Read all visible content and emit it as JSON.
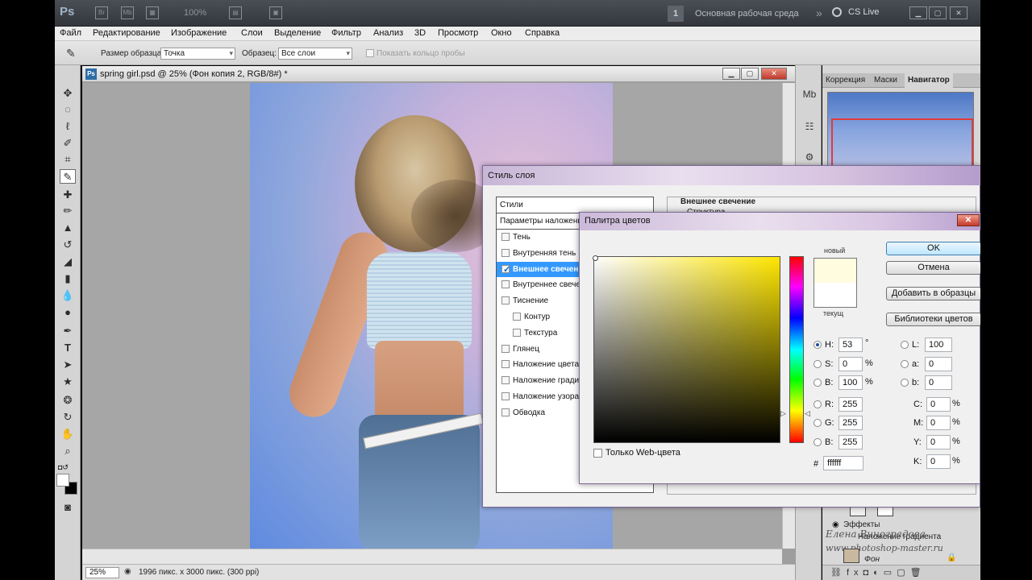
{
  "appbar": {
    "app_icon": "Ps",
    "zoom": "100%",
    "workspace_number": "1",
    "workspace": "Основная рабочая среда",
    "cs_live": "CS Live"
  },
  "menu": [
    "Файл",
    "Редактирование",
    "Изображение",
    "Слои",
    "Выделение",
    "Фильтр",
    "Анализ",
    "3D",
    "Просмотр",
    "Окно",
    "Справка"
  ],
  "options": {
    "sample_size_label": "Размер образца:",
    "sample_size_value": "Точка",
    "sample_label": "Образец:",
    "sample_value": "Все слои",
    "show_ring_label": "Показать кольцо пробы"
  },
  "document": {
    "title": "spring girl.psd @ 25% (Фон копия 2, RGB/8#) *",
    "zoom": "25%",
    "info": "1996 пикс. x 3000 пикс. (300 ppi)"
  },
  "right_panel": {
    "tabs": [
      "Коррекция",
      "Маски",
      "Навигатор"
    ],
    "active_tab": "Навигатор",
    "layers": {
      "effects": "Эффекты",
      "gradient_overlay": "Наложение градиента",
      "background": "Фон"
    },
    "watermark_name": "Елена Виноградова",
    "watermark_url": "www.photoshop-master.ru"
  },
  "layer_style": {
    "title": "Стиль слоя",
    "styles_header": "Стили",
    "blend_options": "Параметры наложения...",
    "items": [
      {
        "label": "Тень",
        "checked": false,
        "indent": false
      },
      {
        "label": "Внутренняя тень",
        "checked": false,
        "indent": false
      },
      {
        "label": "Внешнее свечение",
        "checked": true,
        "indent": false,
        "selected": true
      },
      {
        "label": "Внутреннее свечение",
        "checked": false,
        "indent": false
      },
      {
        "label": "Тиснение",
        "checked": false,
        "indent": false
      },
      {
        "label": "Контур",
        "checked": false,
        "indent": true
      },
      {
        "label": "Текстура",
        "checked": false,
        "indent": true
      },
      {
        "label": "Глянец",
        "checked": false,
        "indent": false
      },
      {
        "label": "Наложение цвета",
        "checked": false,
        "indent": false
      },
      {
        "label": "Наложение градиента",
        "checked": false,
        "indent": false
      },
      {
        "label": "Наложение узора",
        "checked": false,
        "indent": false
      },
      {
        "label": "Обводка",
        "checked": false,
        "indent": false
      }
    ],
    "group_title": "Внешнее свечение",
    "group_sub": "Структура"
  },
  "color_picker": {
    "title": "Палитра цветов",
    "new_label": "новый",
    "current_label": "текущ",
    "new_color": "#fffce0",
    "current_color": "#ffffff",
    "hue_color": "#ffe600",
    "buttons": {
      "ok": "OK",
      "cancel": "Отмена",
      "add_swatch": "Добавить в образцы",
      "libraries": "Библиотеки цветов"
    },
    "hsb": {
      "H": "53",
      "S": "0",
      "B": "100",
      "h_unit": "°",
      "s_unit": "%",
      "b_unit": "%"
    },
    "rgb": {
      "R": "255",
      "G": "255",
      "B": "255"
    },
    "lab": {
      "L": "100",
      "a": "0",
      "b": "0"
    },
    "cmyk": {
      "C": "0",
      "M": "0",
      "Y": "0",
      "K": "0",
      "unit": "%"
    },
    "hex_label": "#",
    "hex": "ffffff",
    "web_only_label": "Только Web-цвета",
    "web_only": false
  }
}
